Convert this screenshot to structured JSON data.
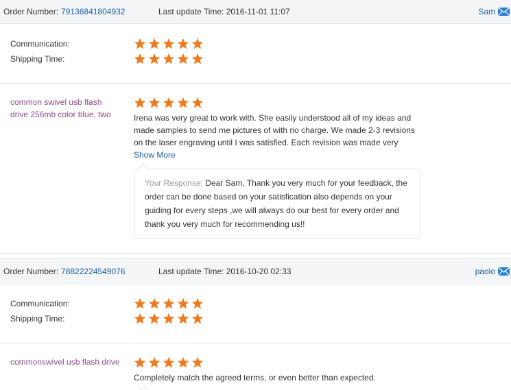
{
  "colors": {
    "star": "#f07a1c",
    "link": "#1a5fa8",
    "product": "#8a4f8e",
    "header_bg": "#f4f5f7"
  },
  "labels": {
    "order_number": "Order Number:",
    "last_update": "Last update Time:",
    "communication": "Communication:",
    "shipping_time": "Shipping Time:",
    "show_more": "Show More",
    "your_response": "Your Response:"
  },
  "orders": [
    {
      "order_number": "79136841804932",
      "last_update_time": "2016-11-01 11:07",
      "buyer": "Sam",
      "communication_stars": 5,
      "shipping_stars": 5,
      "product": "common swivel usb flash drive 256mb color blue, two",
      "product_stars": 5,
      "review": "Irena was very great to work with. She easily understood all of my ideas and made samples to send me pictures of with no charge. We made 2-3 revisions on the laser engraving until I was satisfied. Each revision was made very",
      "response": "Dear Sam, Thank you very much for your feedback, the order can be done based on your satisfication also depends on your guiding for every steps ,we will always do our best for every order and thank you very much for recommending us!!"
    },
    {
      "order_number": "78822224549076",
      "last_update_time": "2016-10-20 02:33",
      "buyer": "paolo",
      "communication_stars": 5,
      "shipping_stars": 5,
      "product": "commonswivel usb flash drive",
      "product_stars": 5,
      "review": "Completely match the agreed terms, or even better than expected."
    }
  ]
}
